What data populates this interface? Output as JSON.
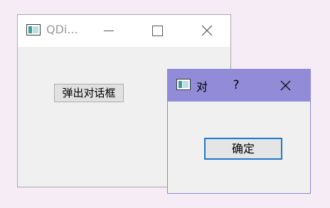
{
  "main_window": {
    "title": "QDi...",
    "popup_button_label": "弹出对话框"
  },
  "dialog": {
    "title": "对",
    "help_label": "?",
    "ok_label": "确定"
  },
  "icons": {
    "app": "app-window-icon",
    "minimize": "minimize-icon",
    "maximize": "maximize-icon",
    "close": "close-icon"
  },
  "colors": {
    "background": "#f6ecf6",
    "window_body": "#f0f0f0",
    "dialog_titlebar_active": "#918bd8",
    "focus_border": "#1f7ac9"
  }
}
